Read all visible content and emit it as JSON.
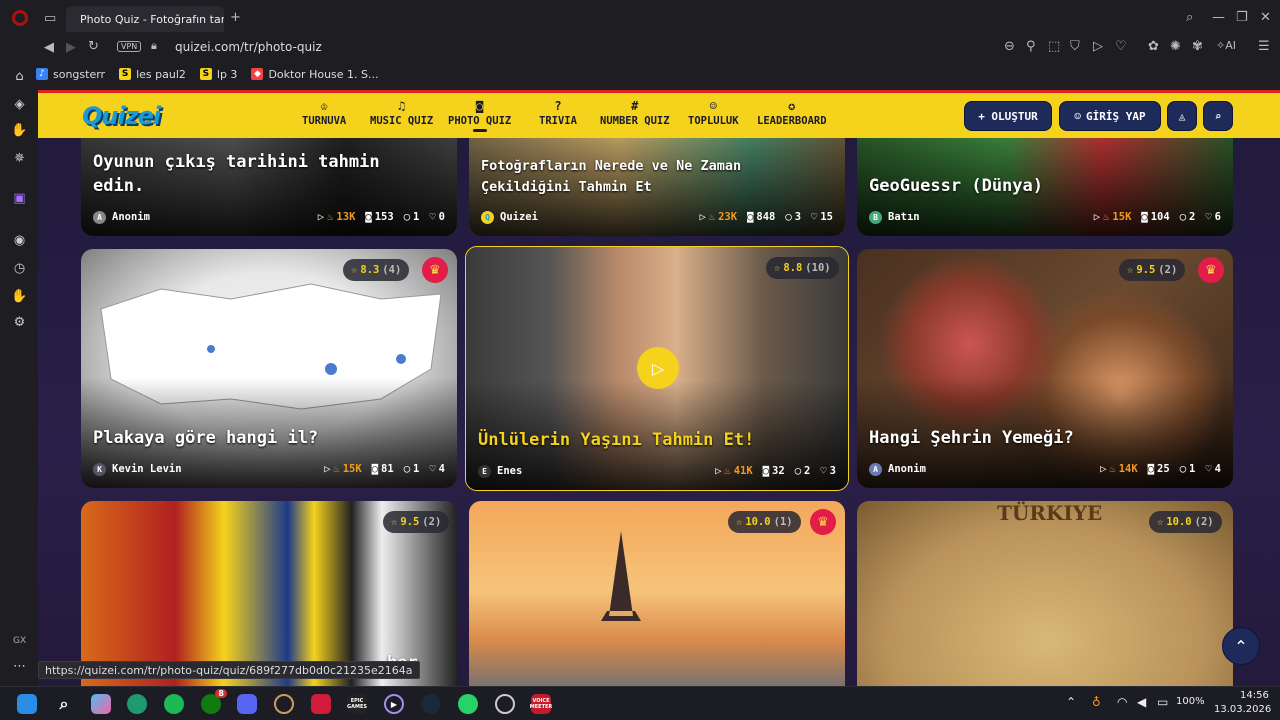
{
  "browser": {
    "tab_title": "Photo Quiz - Fotoğrafın tar",
    "vpn_label": "VPN",
    "url": "quizei.com/tr/photo-quiz",
    "ai_label": "AI",
    "bookmarks": [
      {
        "label": "songsterr",
        "icon": "songsterr-icon"
      },
      {
        "label": "les paul2",
        "icon": "S"
      },
      {
        "label": "lp 3",
        "icon": "S"
      },
      {
        "label": "Doktor House 1. S...",
        "icon": "doktor-house-icon"
      }
    ],
    "sidebar_bottom_label": "GX",
    "status_url": "https://quizei.com/tr/photo-quiz/quiz/689f277db0d0c21235e2164a"
  },
  "site": {
    "logo": "Quizei",
    "nav": [
      {
        "label": "TURNUVA",
        "icon": "trophy-icon",
        "glyph": "♔"
      },
      {
        "label": "MUSIC QUIZ",
        "icon": "music-icon",
        "glyph": "♫"
      },
      {
        "label": "PHOTO QUIZ",
        "icon": "camera-icon",
        "glyph": "◙"
      },
      {
        "label": "TRIVIA",
        "icon": "question-icon",
        "glyph": "?"
      },
      {
        "label": "NUMBER QUIZ",
        "icon": "hash-icon",
        "glyph": "#"
      },
      {
        "label": "TOPLULUK",
        "icon": "users-icon",
        "glyph": "☺"
      },
      {
        "label": "LEADERBOARD",
        "icon": "badge-icon",
        "glyph": "✪"
      }
    ],
    "create_label": "+ OLUŞTUR",
    "login_label": "GİRİŞ YAP"
  },
  "cards": [
    {
      "title": "Oyunun çıkış tarihini tahmin edin.",
      "author": "Anonim",
      "avatar": "A",
      "plays": "13K",
      "photos": "153",
      "comments": "1",
      "likes": "0"
    },
    {
      "title": "Fotoğrafların Nerede ve Ne Zaman Çekildiğini Tahmin Et",
      "author": "Quizei",
      "avatar": "Q",
      "plays": "23K",
      "photos": "848",
      "comments": "3",
      "likes": "15"
    },
    {
      "title": "GeoGuessr (Dünya)",
      "author": "Batın",
      "avatar": "B",
      "plays": "15K",
      "photos": "104",
      "comments": "2",
      "likes": "6"
    },
    {
      "title": "Plakaya göre hangi il?",
      "author": "Kevin Levin",
      "avatar": "K",
      "plays": "15K",
      "photos": "81",
      "comments": "1",
      "likes": "4",
      "rating": "8.3",
      "rating_count": "(4)",
      "premium": true
    },
    {
      "title": "Ünlülerin Yaşını Tahmin Et!",
      "author": "Enes",
      "avatar": "E",
      "plays": "41K",
      "photos": "32",
      "comments": "2",
      "likes": "3",
      "rating": "8.8",
      "rating_count": "(10)"
    },
    {
      "title": "Hangi Şehrin Yemeği?",
      "author": "Anonim",
      "avatar": "A",
      "plays": "14K",
      "photos": "25",
      "comments": "1",
      "likes": "4",
      "rating": "9.5",
      "rating_count": "(2)",
      "premium": true
    },
    {
      "title": "ber",
      "rating": "9.5",
      "rating_count": "(2)"
    },
    {
      "title": "",
      "rating": "10.0",
      "rating_count": "(1)",
      "premium": true
    },
    {
      "title": "TÜRKIYE",
      "rating": "10.0",
      "rating_count": "(2)"
    }
  ],
  "taskbar": {
    "battery": "100%",
    "time": "14:56",
    "date": "13.03.2026",
    "xbox_badge": "8",
    "epic_label": "EPIC\nGAMES",
    "voice_label": "VOICE\nMEETER"
  }
}
